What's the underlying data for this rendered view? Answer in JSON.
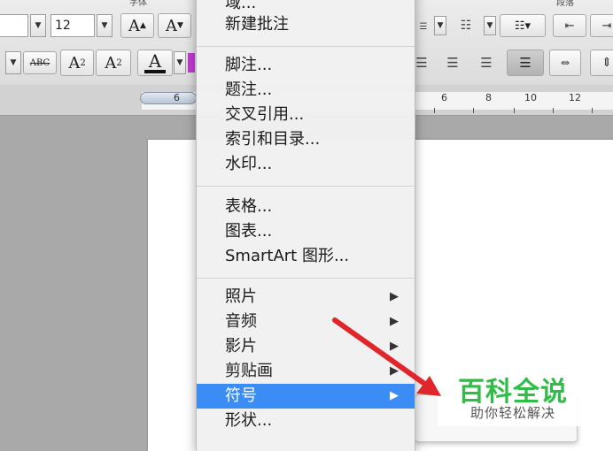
{
  "ribbon": {
    "group_font_label": "字体",
    "group_paragraph_label": "段落",
    "font_size": "12",
    "grow_font": "A",
    "shrink_font": "A",
    "strike_label": "ABC",
    "superscript_base": "A",
    "superscript_mark": "2",
    "subscript_base": "A",
    "subscript_mark": "2",
    "font_color_glyph": "A"
  },
  "ruler": {
    "labels": [
      "6",
      "6",
      "8",
      "10",
      "12"
    ]
  },
  "menu": {
    "items": [
      {
        "label": "域...",
        "submenu": false
      },
      {
        "label": "新建批注",
        "submenu": false
      },
      {
        "label": "脚注...",
        "submenu": false
      },
      {
        "label": "题注...",
        "submenu": false
      },
      {
        "label": "交叉引用...",
        "submenu": false
      },
      {
        "label": "索引和目录...",
        "submenu": false
      },
      {
        "label": "水印...",
        "submenu": false
      },
      {
        "label": "表格...",
        "submenu": false
      },
      {
        "label": "图表...",
        "submenu": false
      },
      {
        "label": "SmartArt 图形...",
        "submenu": false
      },
      {
        "label": "照片",
        "submenu": true
      },
      {
        "label": "音频",
        "submenu": true
      },
      {
        "label": "影片",
        "submenu": true
      },
      {
        "label": "剪贴画",
        "submenu": true
      },
      {
        "label": "符号",
        "submenu": true,
        "selected": true
      },
      {
        "label": "形状...",
        "submenu": false
      }
    ],
    "submenu_glyph": "▶"
  },
  "watermark": {
    "title": "百科全说",
    "subtitle": "助你轻松解决",
    "title_color": "#2fbd47"
  },
  "colors": {
    "selection": "#3b8cf5",
    "arrow": "#e0262b"
  }
}
